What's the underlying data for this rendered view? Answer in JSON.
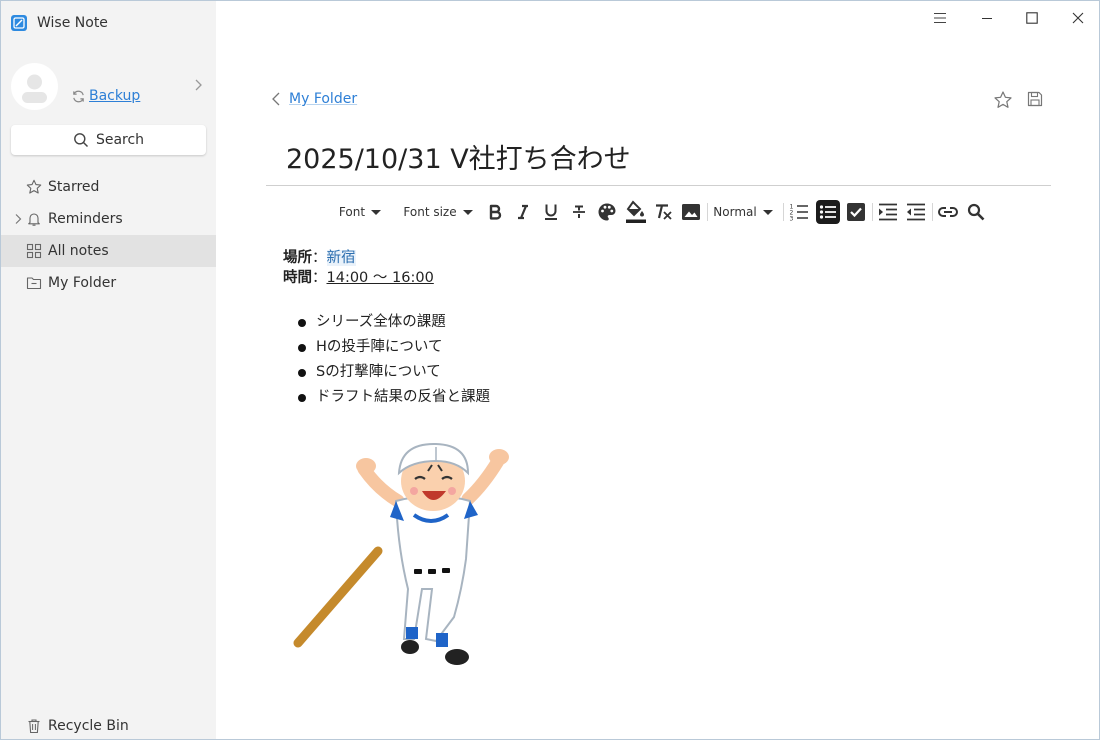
{
  "app": {
    "title": "Wise Note"
  },
  "sidebar": {
    "backup_label": "Backup",
    "search_label": "Search",
    "items": [
      {
        "label": "Starred",
        "icon": "star-icon"
      },
      {
        "label": "Reminders",
        "icon": "bell-icon"
      },
      {
        "label": "All notes",
        "icon": "grid-icon",
        "active": true
      },
      {
        "label": "My Folder",
        "icon": "folder-icon"
      }
    ],
    "recycle_label": "Recycle Bin"
  },
  "note": {
    "breadcrumb": "My Folder",
    "title": "2025/10/31 V社打ち合わせ",
    "location_label": "場所",
    "location_value": "新宿",
    "time_label": "時間",
    "time_value": "14:00 ～ 16:00",
    "bullets": [
      "シリーズ全体の課題",
      "Hの投手陣について",
      "Sの打撃陣について",
      "ドラフト結果の反省と課題"
    ]
  },
  "toolbar": {
    "font_label": "Font",
    "font_size_label": "Font size",
    "paragraph_label": "Normal"
  },
  "colors": {
    "accent": "#2d7fd6",
    "sidebar_bg": "#f3f3f3",
    "active_item_bg": "#e2e2e2"
  }
}
